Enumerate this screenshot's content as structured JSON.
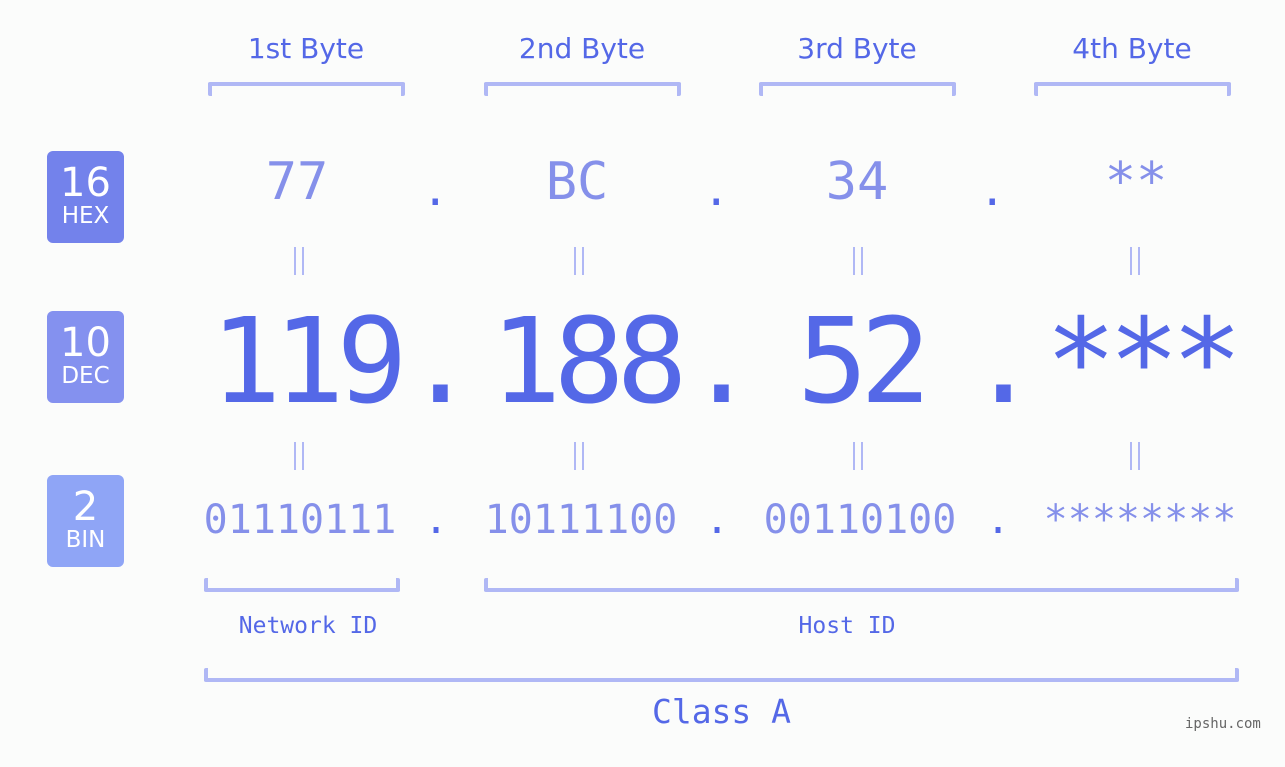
{
  "byte_headers": [
    "1st Byte",
    "2nd Byte",
    "3rd Byte",
    "4th Byte"
  ],
  "bases": [
    {
      "num": "16",
      "label": "HEX",
      "color": "#7382eb"
    },
    {
      "num": "10",
      "label": "DEC",
      "color": "#8491ef"
    },
    {
      "num": "2",
      "label": "BIN",
      "color": "#8fa5f6"
    }
  ],
  "hex": [
    "77",
    "BC",
    "34",
    "**"
  ],
  "dec": [
    "119",
    "188",
    "52",
    "***"
  ],
  "bin": [
    "01110111",
    "10111100",
    "00110100",
    "********"
  ],
  "separator": ".",
  "equals": "=",
  "network_id_label": "Network ID",
  "host_id_label": "Host ID",
  "class_label": "Class A",
  "watermark": "ipshu.com"
}
